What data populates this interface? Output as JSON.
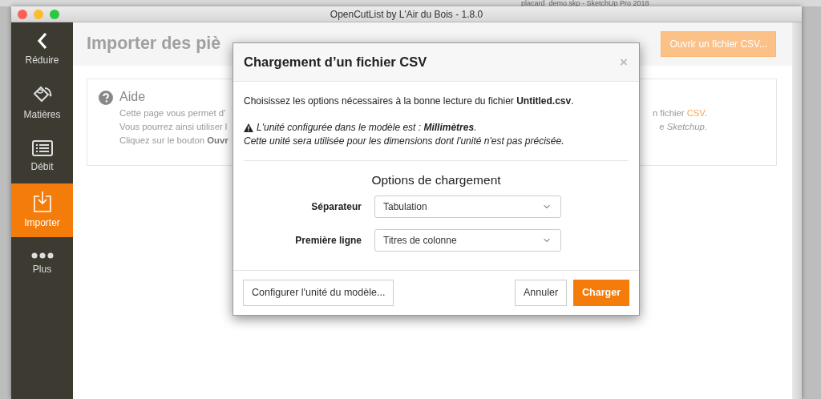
{
  "background_window": {
    "title": "placard_demo.skp - SketchUp Pro 2018"
  },
  "window": {
    "title": "OpenCutList by L'Air du Bois - 1.8.0"
  },
  "sidebar": {
    "items": [
      {
        "label": "Réduire",
        "kind": "chevron",
        "selected": false
      },
      {
        "label": "Matières",
        "kind": "bucket",
        "selected": false
      },
      {
        "label": "Débit",
        "kind": "list",
        "selected": false
      },
      {
        "label": "Importer",
        "kind": "import",
        "selected": true
      },
      {
        "label": "Plus",
        "kind": "dots",
        "selected": false
      }
    ]
  },
  "page": {
    "title": "Importer des piè",
    "open_button": "Ouvrir un fichier CSV...",
    "help": {
      "title": "Aide",
      "lines_left": [
        "Cette page vous permet d'",
        "Vous pourrez ainsi utiliser l",
        "Cliquez sur le bouton **Ouvr**"
      ],
      "lines_right": [
        {
          "before": "n fichier ",
          "link": "CSV",
          "after": "."
        },
        {
          "before": "e *Sketchup*."
        }
      ]
    }
  },
  "modal": {
    "title": "Chargement d’un fichier CSV",
    "close": "×",
    "intro": "Choisissez les options nécessaires à la bonne lecture du fichier **Untitled.csv**.",
    "warning": "L'unité configurée dans le modèle est : **Millimètres**.",
    "note": "Cette unité sera utilisée pour les dimensions dont l'unité n'est pas précisée.",
    "options_title": "Options de chargement",
    "fields": [
      {
        "label": "Séparateur",
        "value": "Tabulation"
      },
      {
        "label": "Première ligne",
        "value": "Titres de colonne"
      }
    ],
    "configure_button": "Configurer l'unité du modèle...",
    "buttons": [
      {
        "label": "Annuler",
        "kind": "secondary"
      },
      {
        "label": "Charger",
        "kind": "primary"
      }
    ]
  }
}
